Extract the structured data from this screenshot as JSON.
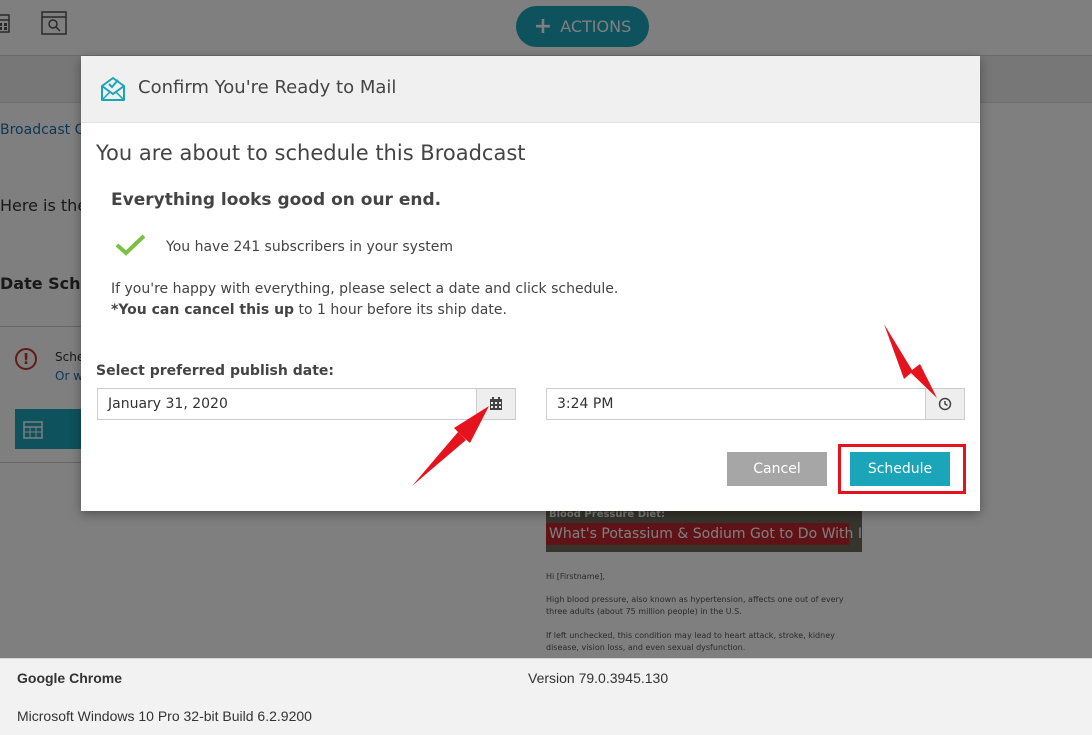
{
  "app": {
    "actions_label": "ACTIONS",
    "breadcrumb_link": "Broadcast Que",
    "intro_text": "Here is the",
    "section_title": "Date Sched",
    "alert_text": "Sche",
    "alert_link": "Or w"
  },
  "email_preview": {
    "subtitle": "Blood Pressure Diet:",
    "headline": "What's Potassium & Sodium Got to Do With It?",
    "greeting": "Hi [Firstname],",
    "para1": "High blood pressure, also known as hypertension, affects one out of every three adults (about 75 million people) in the U.S.",
    "para2": "If left unchecked, this condition may lead to heart attack, stroke, kidney disease, vision loss, and even sexual dysfunction."
  },
  "modal": {
    "title": "Confirm You're Ready to Mail",
    "heading": "You are about to schedule this Broadcast",
    "status": "Everything looks good on our end.",
    "subscribers": "You have 241 subscribers in your system",
    "info_line1": "If you're happy with everything, please select a date and click schedule.",
    "info_line2_bold": "*You can cancel this up",
    "info_line2_rest": " to 1 hour before its ship date.",
    "date_label": "Select preferred publish date:",
    "date_value": "January 31, 2020",
    "time_value": "3:24 PM",
    "cancel_label": "Cancel",
    "schedule_label": "Schedule"
  },
  "footer": {
    "browser": "Google Chrome",
    "version": "Version 79.0.3945.130",
    "os": "Microsoft Windows 10 Pro 32-bit Build 6.2.9200"
  },
  "colors": {
    "accent": "#1aa5b8",
    "highlight": "#e5131d",
    "check": "#7ac143",
    "cancel": "#a6a6a6"
  },
  "icons": {
    "calendar": "calendar-icon",
    "clock": "clock-icon",
    "mail_check": "mail-check-icon",
    "checkmark": "checkmark-icon"
  }
}
